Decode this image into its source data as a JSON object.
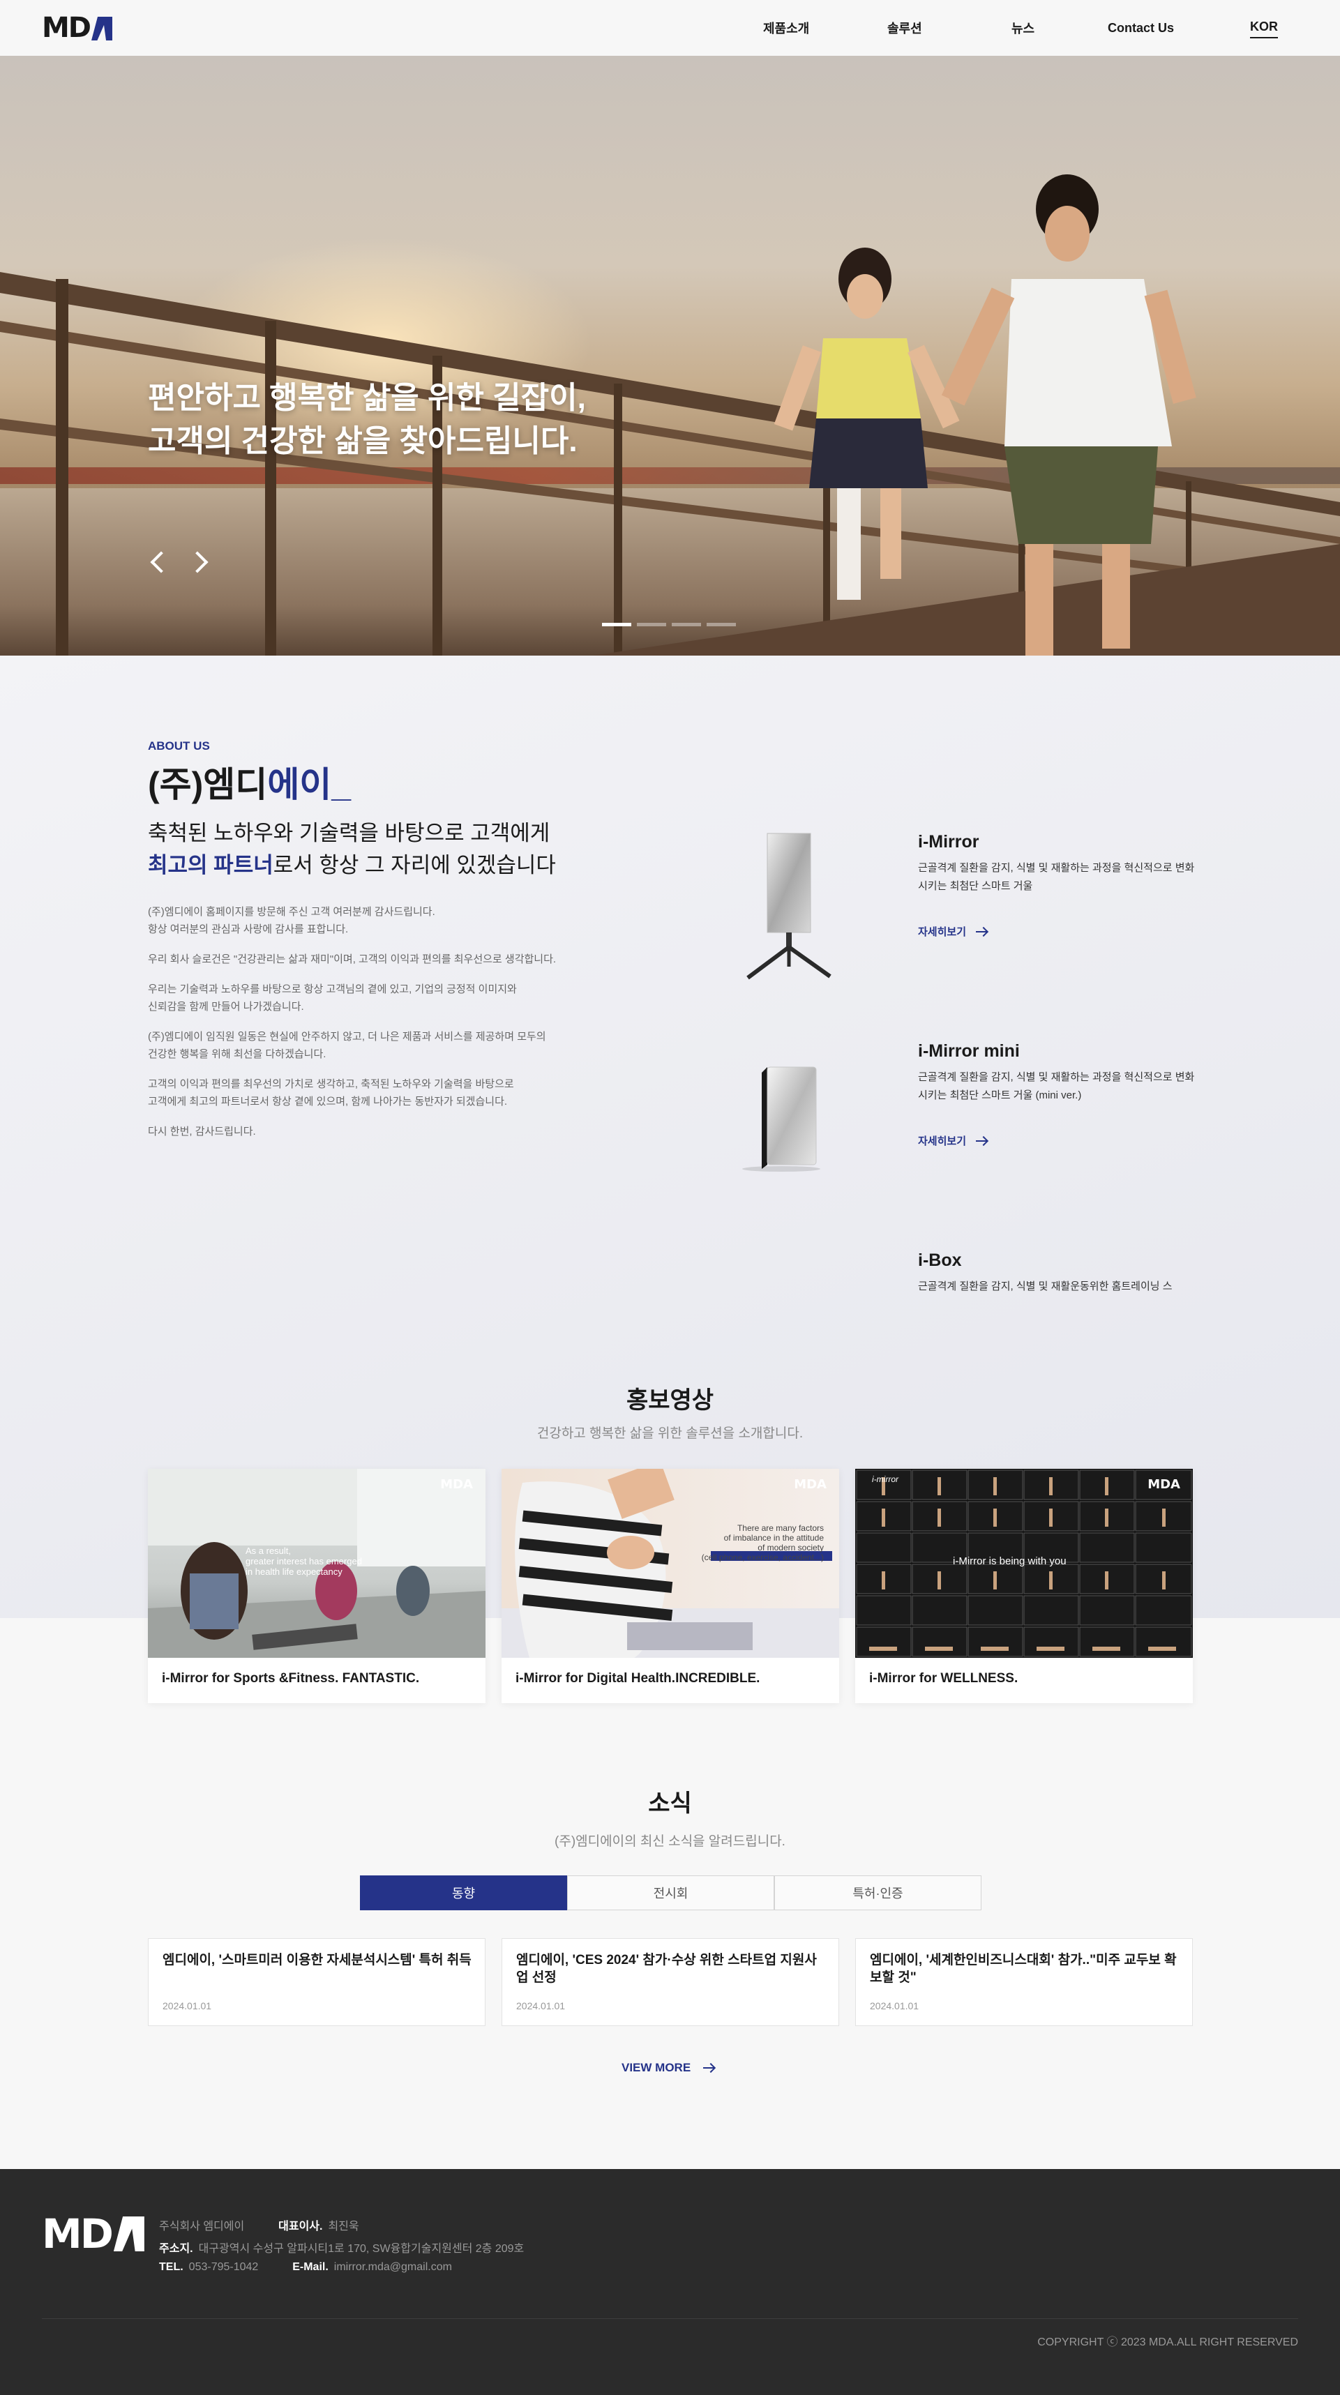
{
  "header": {
    "logo": "MDA",
    "nav": [
      "제품소개",
      "솔루션",
      "뉴스",
      "Contact Us"
    ],
    "lang": "KOR"
  },
  "hero": {
    "line1": "편안하고 행복한 삶을 위한 길잡이,",
    "line2": "고객의 건강한 삶을 찾아드립니다.",
    "slides_total": 4,
    "slide_active": 1
  },
  "about": {
    "label": "ABOUT US",
    "title_black": "(주)엠디",
    "title_blue": "에이_",
    "lead_line1": "축척된 노하우와 기술력을 바탕으로 고객에게",
    "lead_blue": "최고의 파트너",
    "lead_line2_rest": "로서 항상 그 자리에 있겠습니다",
    "paragraphs": [
      "(주)엠디에이 홈페이지를 방문해 주신 고객 여러분께 감사드립니다.\n항상 여러분의 관심과 사랑에 감사를 표합니다.",
      "우리 회사 슬로건은 \"건강관리는 삶과 재미\"이며, 고객의 이익과 편의를 최우선으로 생각합니다.",
      "우리는 기술력과 노하우를 바탕으로 항상 고객님의 곁에 있고, 기업의 긍정적 이미지와\n신뢰감을 함께 만들어 나가겠습니다.",
      "(주)엠디에이 임직원 일동은 현실에 안주하지 않고, 더 나은 제품과 서비스를 제공하며 모두의\n건강한 행복을 위해 최선을 다하겠습니다.",
      "고객의 이익과 편의를 최우선의 가치로 생각하고, 축적된 노하우와 기술력을 바탕으로\n고객에게 최고의 파트너로서 항상 곁에 있으며, 함께 나아가는 동반자가 되겠습니다.",
      "다시 한번, 감사드립니다."
    ],
    "products": [
      {
        "name": "i-Mirror",
        "desc": "근골격계 질환을 감지, 식별 및 재활하는 과정을 혁신적으로 변화시키는 최첨단 스마트 거울",
        "more": "자세히보기"
      },
      {
        "name": "i-Mirror mini",
        "desc": "근골격계 질환을 감지, 식별 및 재활하는 과정을 혁신적으로 변화시키는 최첨단 스마트 거울 (mini ver.)",
        "more": "자세히보기"
      },
      {
        "name": "i-Box",
        "desc": "근골격계 질환을 감지, 식별 및 재활운동위한 홈트레이닝 스"
      }
    ]
  },
  "promo": {
    "title": "홍보영상",
    "subtitle": "건강하고 행복한 삶을 위한 솔루션을 소개합니다.",
    "videos": [
      {
        "caption": "i-Mirror for Sports &Fitness. FANTASTIC.",
        "overlay": "As a result,\ngreater interest has emerged\nin health life expectancy"
      },
      {
        "caption": "i-Mirror for Digital Health.INCREDIBLE.",
        "overlay": "There are many factors\nof imbalance in the attitude\nof modern society\n(cell phone, exercise, accident...)"
      },
      {
        "caption": "i-Mirror for WELLNESS.",
        "overlay": "i-Mirror is being with you"
      }
    ]
  },
  "news": {
    "title": "소식",
    "subtitle": "(주)엠디에이의 최신 소식을 알려드립니다.",
    "tabs": [
      "동향",
      "전시회",
      "특허·인증"
    ],
    "items": [
      {
        "title": "엠디에이, '스마트미러 이용한 자세분석시스템' 특허 취득",
        "date": "2024.01.01"
      },
      {
        "title": "엠디에이, 'CES 2024' 참가·수상 위한 스타트업 지원사업 선정",
        "date": "2024.01.01"
      },
      {
        "title": "엠디에이, '세계한인비즈니스대회' 참가..\"미주 교두보 확보할 것\"",
        "date": "2024.01.01"
      }
    ],
    "view_more": "VIEW MORE"
  },
  "footer": {
    "company": "주식회사 엠디에이",
    "ceo_label": "대표이사.",
    "ceo": "최진욱",
    "address_label": "주소지.",
    "address": "대구광역시 수성구 알파시티1로 170, SW융합기술지원센터 2층 209호",
    "tel_label": "TEL.",
    "tel": "053-795-1042",
    "email_label": "E-Mail.",
    "email": "imirror.mda@gmail.com",
    "copyright": "COPYRIGHT ⓒ 2023 MDA.ALL RIGHT RESERVED"
  }
}
